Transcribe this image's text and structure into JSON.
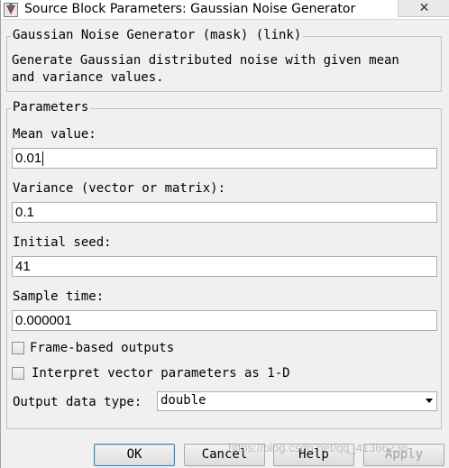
{
  "window": {
    "title": "Source Block Parameters: Gaussian Noise Generator",
    "close_icon": "✕",
    "app_icon": "simulink-block-icon"
  },
  "mask": {
    "legend": "Gaussian Noise Generator (mask) (link)",
    "description": "Generate Gaussian distributed noise with given mean\nand variance values."
  },
  "parameters": {
    "legend": "Parameters",
    "mean": {
      "label": "Mean value:",
      "value": "0.01"
    },
    "variance": {
      "label": "Variance (vector or matrix):",
      "value": "0.1"
    },
    "seed": {
      "label": "Initial seed:",
      "value": "41"
    },
    "sample_time": {
      "label": "Sample time:",
      "value": "0.000001"
    },
    "frame_based": {
      "label": "Frame-based outputs",
      "checked": false
    },
    "interpret_1d": {
      "label": "Interpret vector parameters as 1-D",
      "checked": false
    },
    "output_type": {
      "label": "Output data type:",
      "value": "double"
    }
  },
  "buttons": {
    "ok": "OK",
    "cancel": "Cancel",
    "help": "Help",
    "apply": "Apply"
  },
  "watermark": "https://blog.csdn.net/qq_41366236"
}
